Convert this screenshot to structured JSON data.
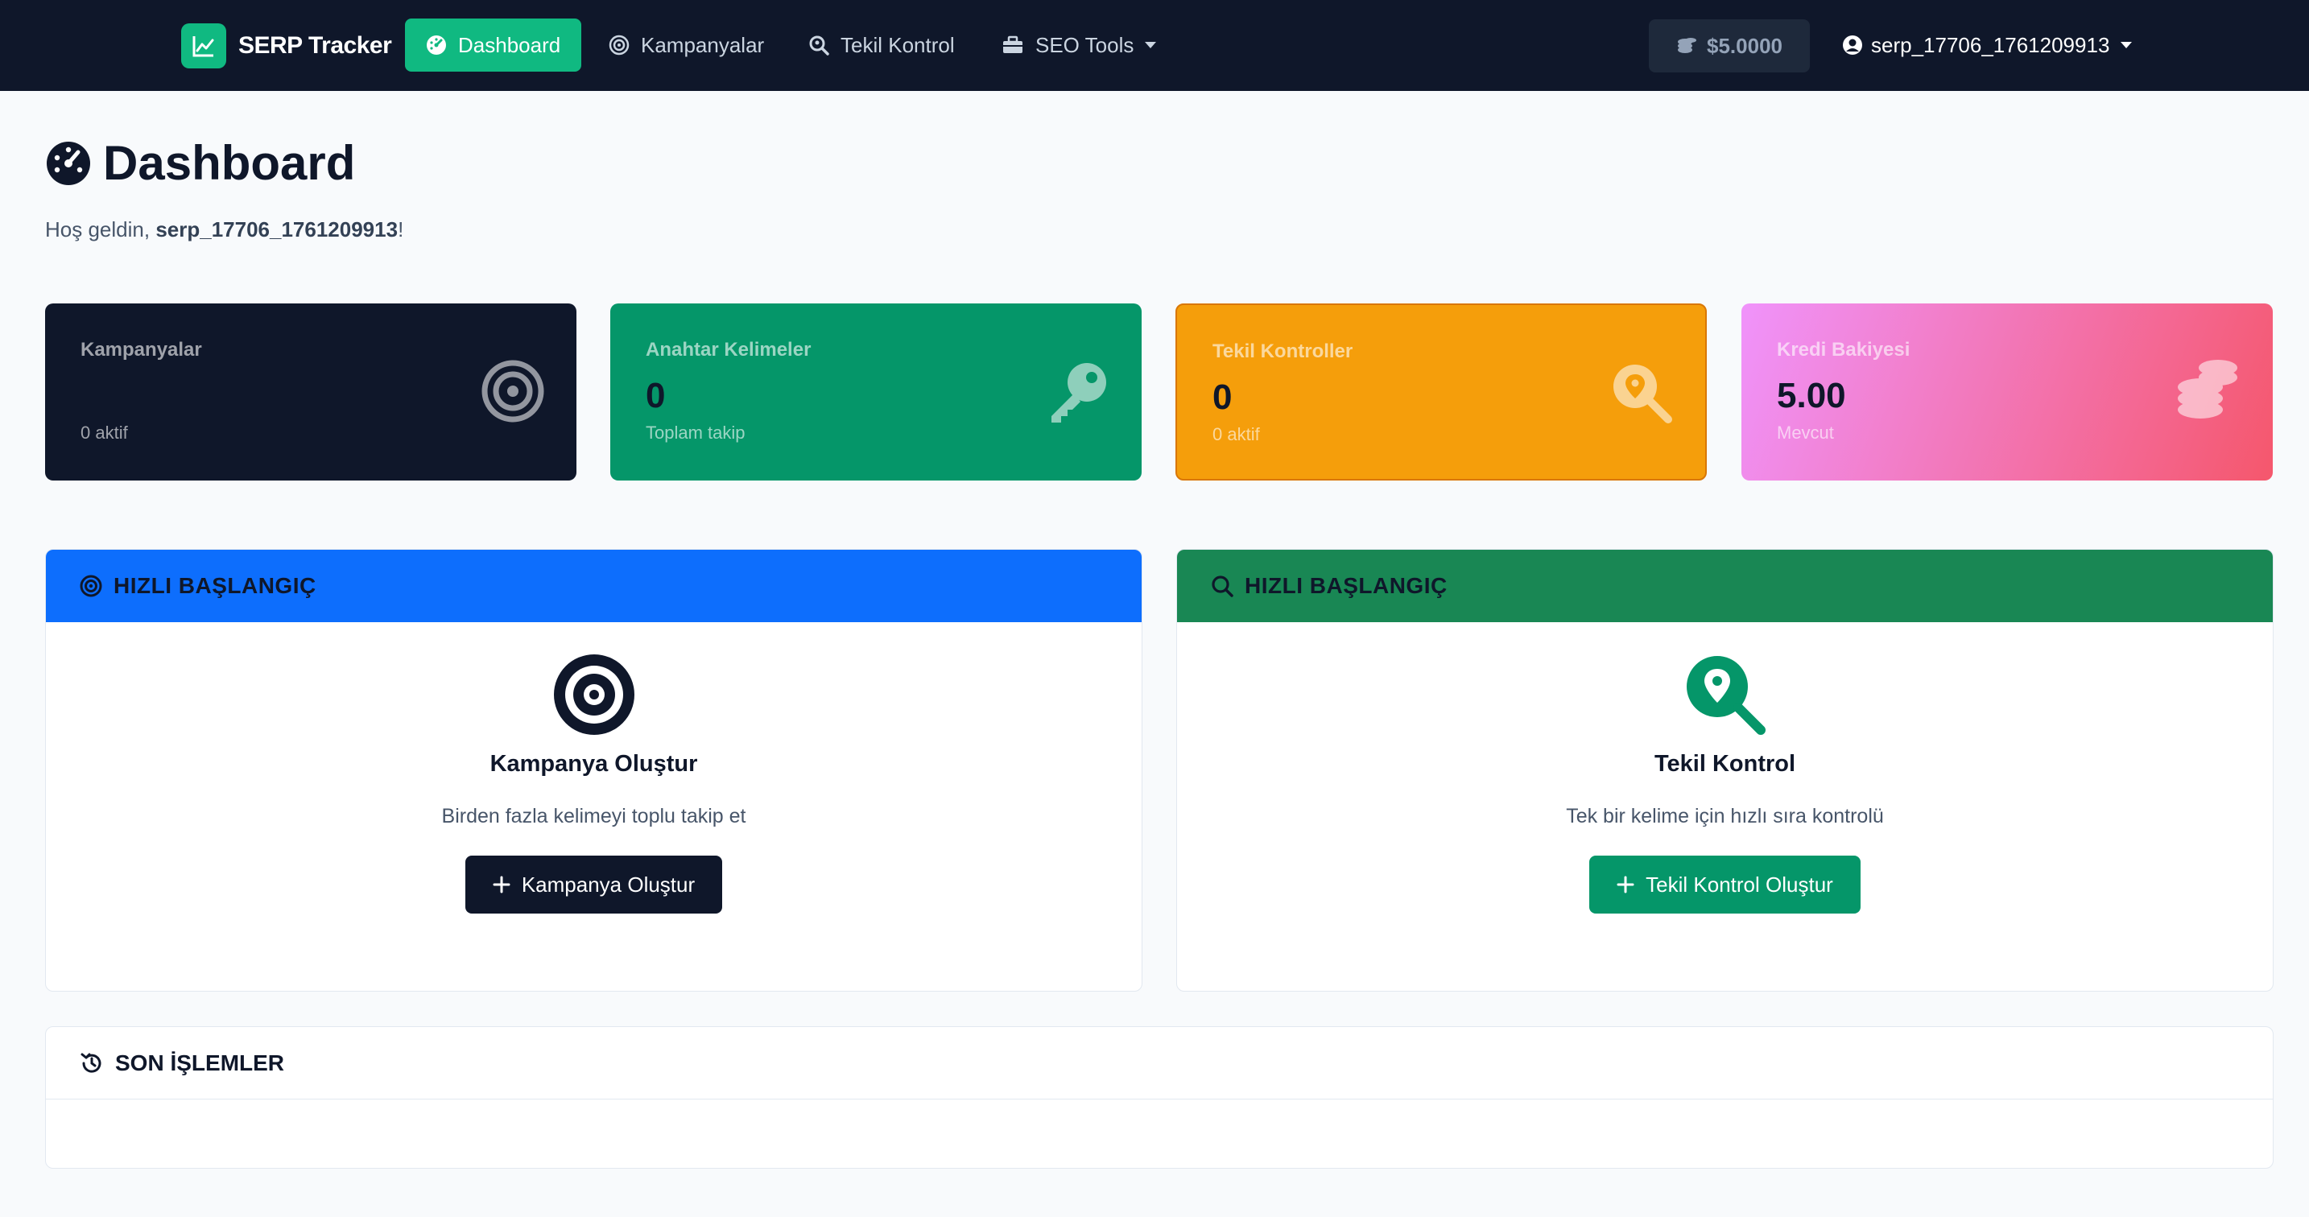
{
  "navbar": {
    "brand": "SERP Tracker",
    "items": [
      {
        "label": "Dashboard",
        "icon": "gauge-icon",
        "active": true
      },
      {
        "label": "Kampanyalar",
        "icon": "target-icon"
      },
      {
        "label": "Tekil Kontrol",
        "icon": "search-location-icon"
      },
      {
        "label": "SEO Tools",
        "icon": "toolbox-icon"
      }
    ],
    "credit": "$5.0000",
    "user": "serp_17706_1761209913"
  },
  "page": {
    "title": "Dashboard",
    "welcome_prefix": "Hoş geldin, ",
    "username": "serp_17706_1761209913",
    "welcome_suffix": "!"
  },
  "stats": [
    {
      "label": "Kampanyalar",
      "value": "",
      "sub": "0 aktif",
      "icon": "bullseye-icon",
      "color": "#0f172a"
    },
    {
      "label": "Anahtar Kelimeler",
      "value": "0",
      "sub": "Toplam takip",
      "icon": "key-icon",
      "color": "#059669"
    },
    {
      "label": "Tekil Kontroller",
      "value": "0",
      "sub": "0 aktif",
      "icon": "search-location-icon",
      "color": "#f59e0b"
    },
    {
      "label": "Kredi Bakiyesi",
      "value": "5.00",
      "sub": "Mevcut",
      "icon": "coins-icon",
      "color": "#f5576c"
    }
  ],
  "quick_left": {
    "header": "HIZLI BAŞLANGIÇ",
    "title": "Kampanya Oluştur",
    "desc": "Birden fazla kelimeyi toplu takip et",
    "button": "Kampanya Oluştur",
    "color": "#0d6efd"
  },
  "quick_right": {
    "header": "HIZLI BAŞLANGIÇ",
    "title": "Tekil Kontrol",
    "desc": "Tek bir kelime için hızlı sıra kontrolü",
    "button": "Tekil Kontrol Oluştur",
    "color": "#198754"
  },
  "recent": {
    "header": "SON İŞLEMLER"
  }
}
